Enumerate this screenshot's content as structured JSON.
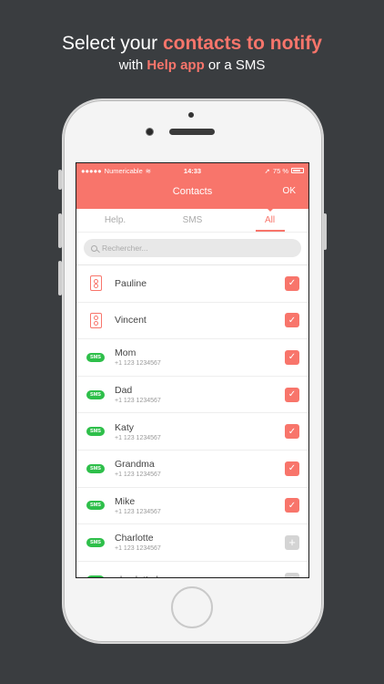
{
  "headline": {
    "line1_prefix": "Select your ",
    "line1_accent": "contacts to notify",
    "line2_prefix": "with ",
    "line2_accent": "Help app",
    "line2_suffix": " or a SMS"
  },
  "status_bar": {
    "carrier": "Numericable",
    "time": "14:33",
    "battery": "75 %"
  },
  "nav": {
    "title": "Contacts",
    "ok_label": "OK"
  },
  "tabs": [
    {
      "label": "Help.",
      "active": false
    },
    {
      "label": "SMS",
      "active": false
    },
    {
      "label": "All",
      "active": true
    }
  ],
  "search": {
    "placeholder": "Rechercher..."
  },
  "contacts": [
    {
      "name": "Pauline",
      "phone": "",
      "type": "app-icon",
      "checked": true
    },
    {
      "name": "Vincent",
      "phone": "",
      "type": "app-icon",
      "checked": true
    },
    {
      "name": "Mom",
      "phone": "+1 123 1234567",
      "type": "sms",
      "checked": true
    },
    {
      "name": "Dad",
      "phone": "+1 123 1234567",
      "type": "sms",
      "checked": true
    },
    {
      "name": "Katy",
      "phone": "+1 123 1234567",
      "type": "sms",
      "checked": true
    },
    {
      "name": "Grandma",
      "phone": "+1 123 1234567",
      "type": "sms",
      "checked": true
    },
    {
      "name": "Mike",
      "phone": "+1 123 1234567",
      "type": "sms",
      "checked": true
    },
    {
      "name": "Charlotte",
      "phone": "+1 123 1234567",
      "type": "sms",
      "checked": false
    },
    {
      "name": "absolutLabs",
      "phone": "",
      "type": "sms",
      "checked": false
    }
  ],
  "sms_badge_label": "SMS",
  "colors": {
    "accent": "#f8756b",
    "sms_green": "#2ebf4a",
    "background": "#3a3d40"
  }
}
